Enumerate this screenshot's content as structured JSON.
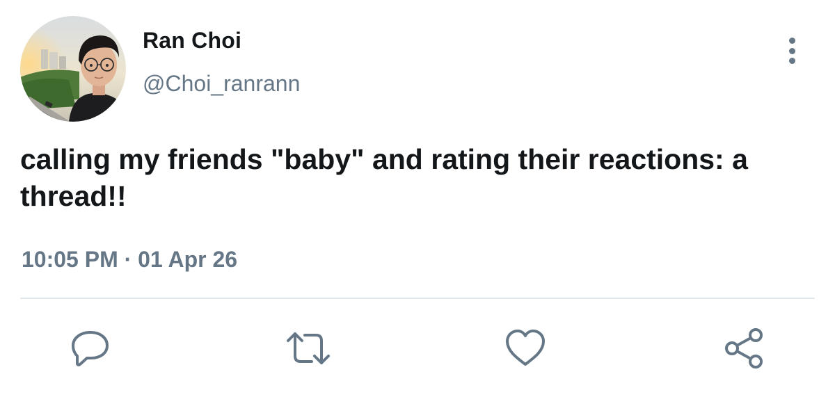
{
  "user": {
    "display_name": "Ran Choi",
    "handle": "@Choi_ranrann",
    "avatar_icon": "profile-photo"
  },
  "tweet": {
    "text": "calling my friends \"baby\" and rating their reactions: a thread!!",
    "timestamp": "10:05 PM · 01 Apr 26"
  },
  "actions": [
    {
      "icon": "reply-icon"
    },
    {
      "icon": "retweet-icon"
    },
    {
      "icon": "like-icon"
    },
    {
      "icon": "share-icon"
    }
  ],
  "colors": {
    "text_primary": "#14171a",
    "text_secondary": "#657786",
    "divider": "#e1e8ed",
    "icon": "#657786"
  }
}
